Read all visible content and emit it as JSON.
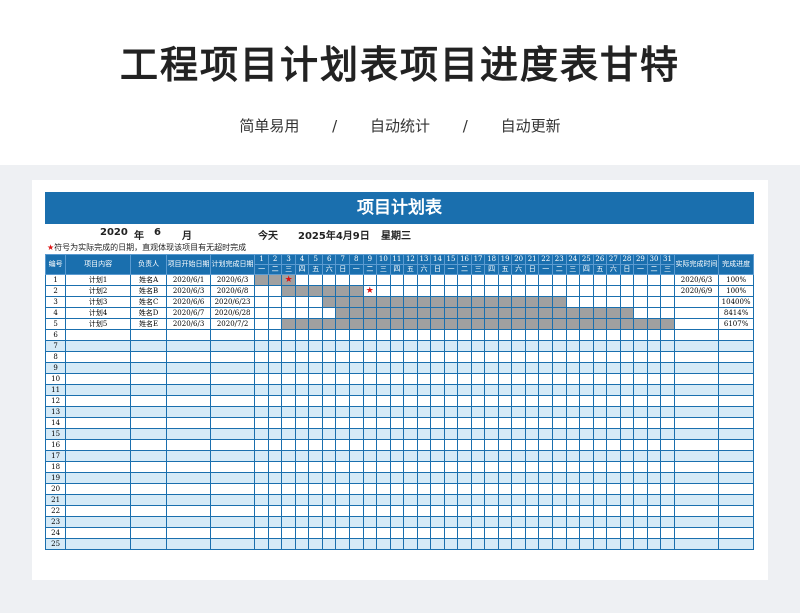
{
  "title": "工程项目计划表项目进度表甘特",
  "tagline": [
    "简单易用",
    "/",
    "自动统计",
    "/",
    "自动更新"
  ],
  "sheet": {
    "banner": "项目计划表",
    "year": "2020",
    "year_unit": "年",
    "month": "6",
    "month_unit": "月",
    "today_label": "今天",
    "today_value": "2025年4月9日",
    "weekday": "星期三",
    "note_star": "★",
    "note_text": "符号为实际完成的日期，直观体现该项目有无超时完成",
    "headers": {
      "no": "编号",
      "content": "项目内容",
      "owner": "负责人",
      "start": "项目开始日期",
      "plan_end": "计划完成日期",
      "actual_end": "实际完成时间",
      "progress": "完成进度"
    },
    "days": [
      "1",
      "2",
      "3",
      "4",
      "5",
      "6",
      "7",
      "8",
      "9",
      "10",
      "11",
      "12",
      "13",
      "14",
      "15",
      "16",
      "17",
      "18",
      "19",
      "20",
      "21",
      "22",
      "23",
      "24",
      "25",
      "26",
      "27",
      "28",
      "29",
      "30",
      "31"
    ],
    "weekdays": [
      "一",
      "二",
      "三",
      "四",
      "五",
      "六",
      "日",
      "一",
      "二",
      "三",
      "四",
      "五",
      "六",
      "日",
      "一",
      "二",
      "三",
      "四",
      "五",
      "六",
      "日",
      "一",
      "二",
      "三",
      "四",
      "五",
      "六",
      "日",
      "一",
      "二",
      "三"
    ],
    "tasks": [
      {
        "no": "1",
        "content": "计划1",
        "owner": "姓名A",
        "start": "2020/6/1",
        "plan_end": "2020/6/3",
        "actual_end": "2020/6/3",
        "progress": "100%",
        "bar_start": 1,
        "bar_end": 3,
        "star_day": 3
      },
      {
        "no": "2",
        "content": "计划2",
        "owner": "姓名B",
        "start": "2020/6/3",
        "plan_end": "2020/6/8",
        "actual_end": "2020/6/9",
        "progress": "100%",
        "bar_start": 3,
        "bar_end": 8,
        "star_day": 9
      },
      {
        "no": "3",
        "content": "计划3",
        "owner": "姓名C",
        "start": "2020/6/6",
        "plan_end": "2020/6/23",
        "actual_end": "",
        "progress": "10400%",
        "bar_start": 6,
        "bar_end": 23,
        "star_day": null
      },
      {
        "no": "4",
        "content": "计划4",
        "owner": "姓名D",
        "start": "2020/6/7",
        "plan_end": "2020/6/28",
        "actual_end": "",
        "progress": "8414%",
        "bar_start": 7,
        "bar_end": 28,
        "star_day": null
      },
      {
        "no": "5",
        "content": "计划5",
        "owner": "姓名E",
        "start": "2020/6/3",
        "plan_end": "2020/7/2",
        "actual_end": "",
        "progress": "6107%",
        "bar_start": 3,
        "bar_end": 31,
        "star_day": null
      }
    ],
    "empty_rows": [
      "6",
      "7",
      "8",
      "9",
      "10",
      "11",
      "12",
      "13",
      "14",
      "15",
      "16",
      "17",
      "18",
      "19",
      "20",
      "21",
      "22",
      "23",
      "24",
      "25"
    ],
    "colors": {
      "header_blue": "#1a6fae",
      "row_alt": "#d5eaf7",
      "bar_gray": "#a0a0a0",
      "star_red": "#dd1111"
    }
  }
}
